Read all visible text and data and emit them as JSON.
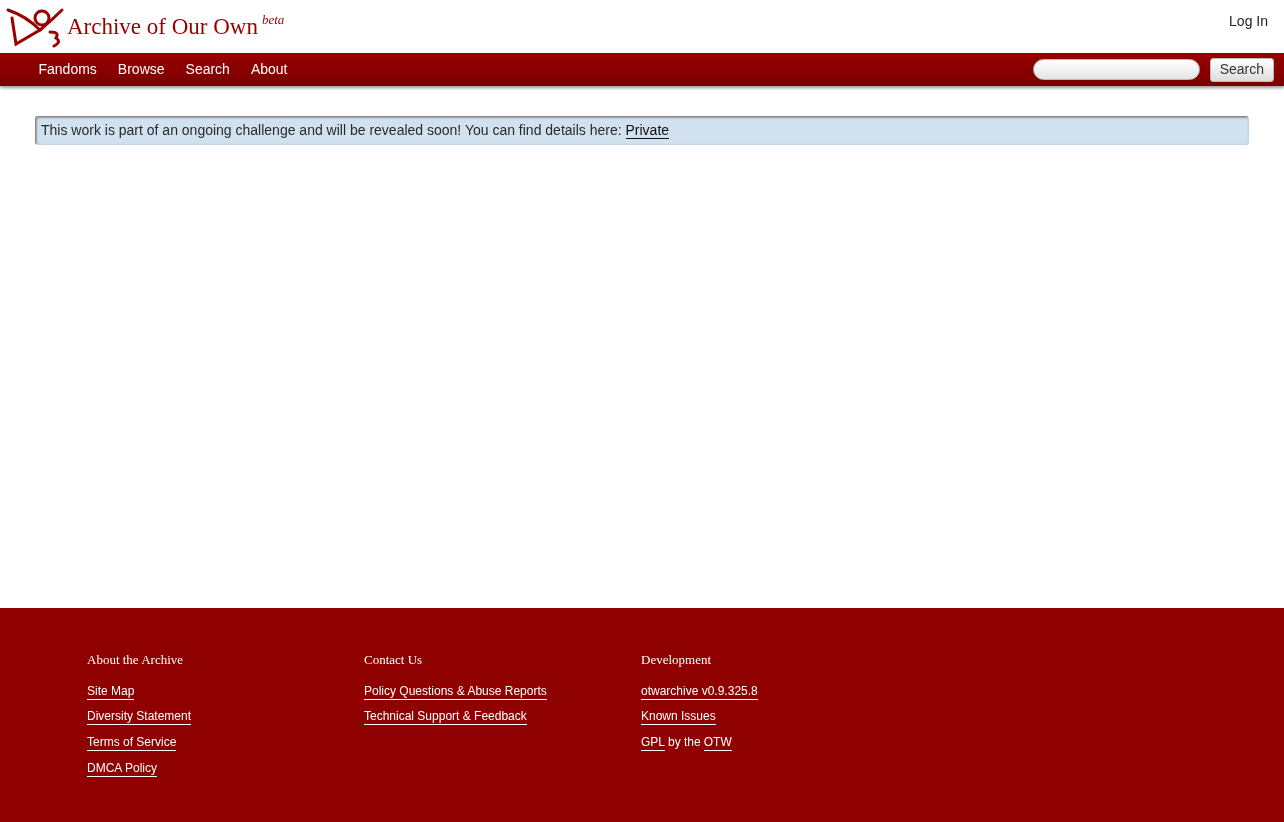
{
  "header": {
    "site_title": "Archive of Our Own",
    "badge": "beta",
    "login": "Log In"
  },
  "nav": {
    "items": [
      "Fandoms",
      "Browse",
      "Search",
      "About"
    ],
    "search": {
      "button": "Search"
    }
  },
  "notice": {
    "text": "This work is part of an ongoing challenge and will be revealed soon! You can find details here:",
    "link": "Private"
  },
  "footer": {
    "columns": [
      {
        "heading": "About the Archive",
        "links": [
          {
            "parts": [
              {
                "text": "Site Map",
                "link": true
              }
            ]
          },
          {
            "parts": [
              {
                "text": "Diversity Statement",
                "link": true
              }
            ]
          },
          {
            "parts": [
              {
                "text": "Terms of Service",
                "link": true
              }
            ]
          },
          {
            "parts": [
              {
                "text": "DMCA Policy",
                "link": true
              }
            ]
          }
        ]
      },
      {
        "heading": "Contact Us",
        "links": [
          {
            "parts": [
              {
                "text": "Policy Questions & Abuse Reports",
                "link": true
              }
            ]
          },
          {
            "parts": [
              {
                "text": "Technical Support & Feedback",
                "link": true
              }
            ]
          }
        ]
      },
      {
        "heading": "Development",
        "links": [
          {
            "parts": [
              {
                "text": "otwarchive v0.9.325.8",
                "link": true
              }
            ]
          },
          {
            "parts": [
              {
                "text": "Known Issues",
                "link": true
              }
            ]
          },
          {
            "parts": [
              {
                "text": "GPL",
                "link": true
              },
              {
                "text": "by the",
                "link": false
              },
              {
                "text": "OTW",
                "link": true
              }
            ]
          }
        ]
      }
    ]
  }
}
